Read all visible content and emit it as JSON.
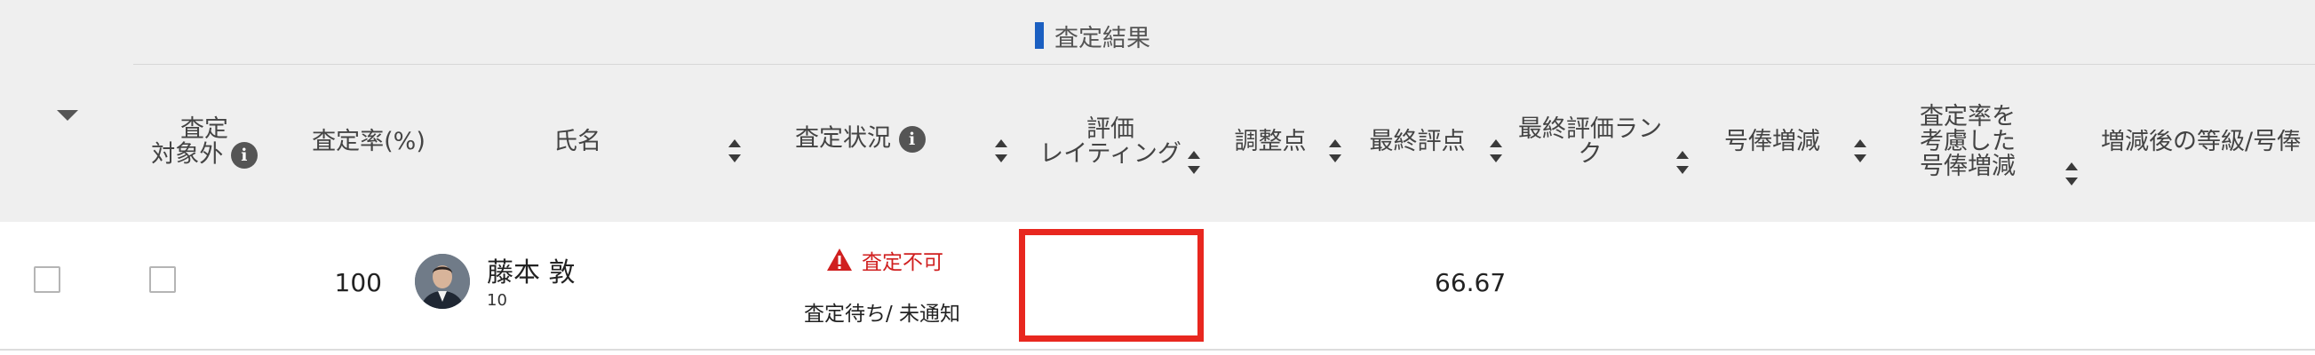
{
  "group_header": {
    "title": "査定結果",
    "accent_color": "#1b5fc1"
  },
  "columns": {
    "excluded_line1": "査定",
    "excluded_line2": "対象外",
    "rate": "査定率(%)",
    "name": "氏名",
    "status": "査定状況",
    "rating_line1": "評価",
    "rating_line2": "レイティング",
    "adjustment": "調整点",
    "final_score": "最終評点",
    "final_rank_line1": "最終評価ラン",
    "final_rank_line2": "ク",
    "salary_change": "号俸増減",
    "rate_adj_line1": "査定率を",
    "rate_adj_line2": "考慮した",
    "rate_adj_line3": "号俸増減",
    "after_grade": "増減後の等級/号俸"
  },
  "row": {
    "rate": "100",
    "name": "藤本 敦",
    "employee_id": "10",
    "warning": "査定不可",
    "status": "査定待ち/ 未通知",
    "final_score": "66.67"
  },
  "colors": {
    "warning": "#d01f1f",
    "highlight_box": "#e8271f"
  }
}
